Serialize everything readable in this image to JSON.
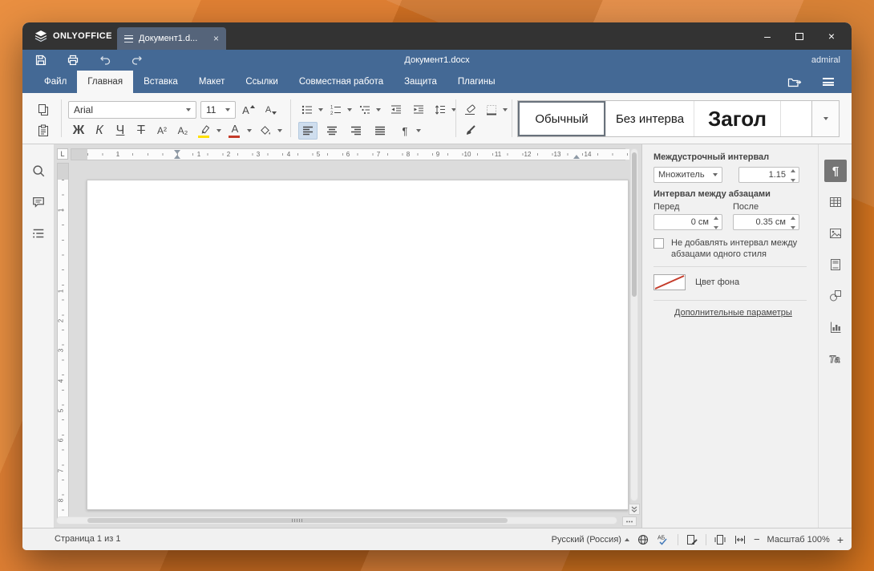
{
  "colors": {
    "accent": "#446995",
    "titlebar": "#333333",
    "desktop": "#d87a2c",
    "highlight_yellow": "#ffe000",
    "font_color_red": "#c43b2a",
    "no_fill_line_red": "#c43b2a"
  },
  "titlebar": {
    "brand": "ONLYOFFICE",
    "tab_title": "Документ1.d...",
    "tab_close": "×",
    "minimize": "–",
    "close": "×"
  },
  "header": {
    "doc_title": "Документ1.docx",
    "user": "admiral"
  },
  "menu": {
    "tabs": [
      {
        "label": "Файл"
      },
      {
        "label": "Главная"
      },
      {
        "label": "Вставка"
      },
      {
        "label": "Макет"
      },
      {
        "label": "Ссылки"
      },
      {
        "label": "Совместная работа"
      },
      {
        "label": "Защита"
      },
      {
        "label": "Плагины"
      }
    ]
  },
  "toolbar": {
    "font_name": "Arial",
    "font_size": "11",
    "grow_font": "A",
    "shrink_font": "A",
    "bold": "Ж",
    "italic": "К",
    "underline": "Ч",
    "strikeout": "Т",
    "superscript": "A²",
    "subscript": "A₂",
    "font_color_letter": "A",
    "nonprinting": "¶",
    "styles": [
      {
        "name": "Обычный"
      },
      {
        "name": "Без интерва"
      },
      {
        "name": "Загол"
      }
    ]
  },
  "ruler": {
    "h_pre": "1",
    "h": [
      "1",
      "2",
      "3",
      "4",
      "5",
      "6",
      "7",
      "8",
      "9",
      "10",
      "11",
      "12",
      "13",
      "14"
    ],
    "v_pre": "1",
    "v": [
      "1",
      "2",
      "3",
      "4",
      "5",
      "6",
      "7",
      "8"
    ]
  },
  "right_panel": {
    "line_spacing_title": "Междустрочный интервал",
    "multiplier": "Множитель",
    "multiplier_value": "1.15",
    "paragraph_spacing_title": "Интервал между абзацами",
    "before_label": "Перед",
    "before_value": "0 см",
    "after_label": "После",
    "after_value": "0.35 см",
    "checkbox_text": "Не добавлять интервал между абзацами одного стиля",
    "bg_color_label": "Цвет фона",
    "advanced_link": "Дополнительные параметры"
  },
  "statusbar": {
    "page_info": "Страница 1 из 1",
    "language": "Русский (Россия)",
    "zoom_out": "−",
    "zoom_label": "Масштаб 100%",
    "zoom_in": "+"
  },
  "icons": {
    "tab_selector": "L",
    "paragraph": "¶",
    "textart": "Ta",
    "spell_letters": "АБ"
  }
}
